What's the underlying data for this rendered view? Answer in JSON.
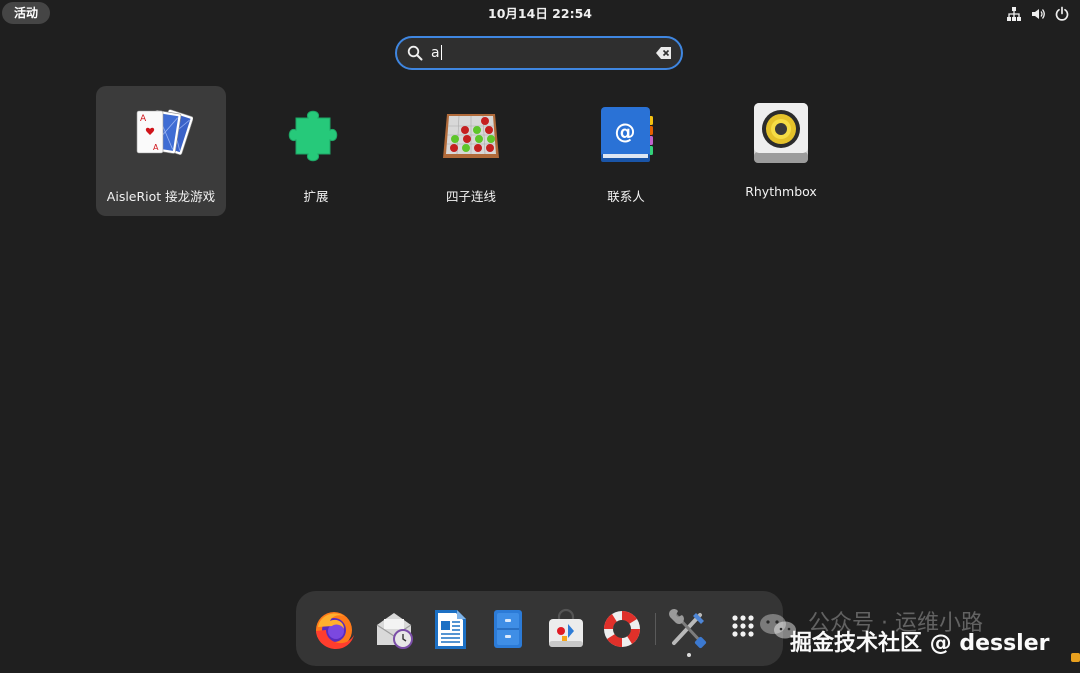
{
  "topbar": {
    "activities_label": "活动",
    "clock": "10月14日  22:54",
    "tray": [
      "network-icon",
      "volume-icon",
      "power-icon"
    ]
  },
  "search": {
    "value": "a",
    "icons": [
      "search-icon",
      "clear-icon"
    ],
    "accent": "#3f86e0"
  },
  "results": [
    {
      "label": "AisleRiot 接龙游戏",
      "icon": "aisleriot-cards-icon",
      "selected": true
    },
    {
      "label": "扩展",
      "icon": "extensions-puzzle-icon"
    },
    {
      "label": "四子连线",
      "icon": "four-in-a-row-icon"
    },
    {
      "label": "联系人",
      "icon": "contacts-book-icon"
    },
    {
      "label": "Rhythmbox",
      "icon": "rhythmbox-speaker-icon"
    }
  ],
  "dock": {
    "items": [
      "firefox-icon",
      "evolution-mail-icon",
      "libreoffice-writer-icon",
      "files-icon",
      "software-center-icon",
      "help-lifebuoy-icon",
      "settings-tools-icon",
      "show-apps-grid-icon"
    ]
  },
  "watermark": {
    "line1": "公众号 · 运维小路",
    "line2": "掘金技术社区 @ dessler"
  }
}
